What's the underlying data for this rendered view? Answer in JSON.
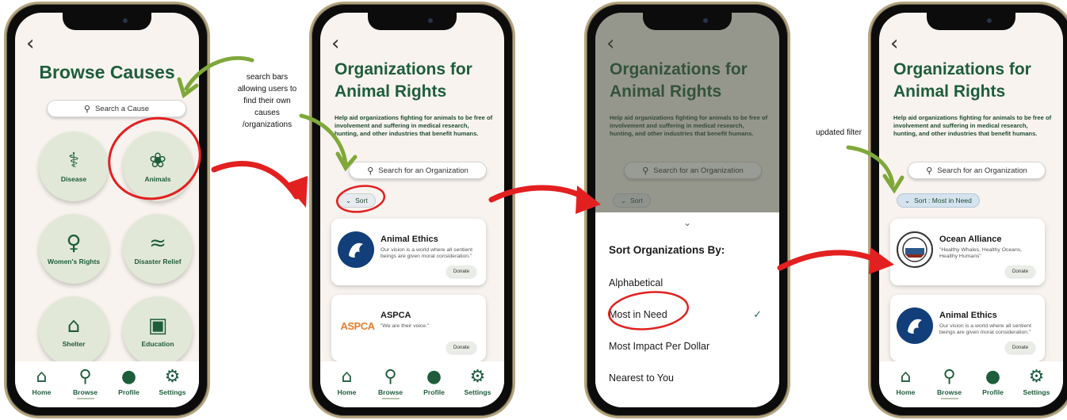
{
  "screen1": {
    "title": "Browse Causes",
    "search_placeholder": "Search a Cause",
    "causes": [
      {
        "label": "Disease",
        "icon": "stethoscope-icon"
      },
      {
        "label": "Animals",
        "icon": "animals-icon"
      },
      {
        "label": "Women's Rights",
        "icon": "female-symbol-icon"
      },
      {
        "label": "Disaster Relief",
        "icon": "wave-icon"
      },
      {
        "label": "Shelter",
        "icon": "house-icon"
      },
      {
        "label": "Education",
        "icon": "book-icon"
      }
    ]
  },
  "org_page": {
    "title": "Organizations for Animal Rights",
    "description": "Help aid organizations fighting for animals to be free of involvement and suffering in medical research, hunting, and other industries that benefit humans.",
    "search_placeholder": "Search for an Organization",
    "sort_label": "Sort",
    "sort_label_updated": "Sort : Most in Need"
  },
  "orgs": {
    "animal_ethics": {
      "name": "Animal Ethics",
      "quote": "Our vision is a world where all sentient beings are given moral consideration.\""
    },
    "aspca": {
      "name": "ASPCA",
      "quote": "\"We are their voice.\"",
      "logo_text": "ASPCA"
    },
    "ocean_alliance": {
      "name": "Ocean Alliance",
      "quote": "\"Healthy Whales, Healthy Oceans, Healthy Humans\""
    },
    "donate_label": "Donate"
  },
  "sort_sheet": {
    "title": "Sort Organizations By:",
    "options": [
      "Alphabetical",
      "Most in Need",
      "Most Impact Per Dollar",
      "Nearest to You"
    ],
    "selected": "Most in Need"
  },
  "tabbar": {
    "tabs": [
      {
        "label": "Home",
        "icon": "home-icon"
      },
      {
        "label": "Browse",
        "icon": "search-icon"
      },
      {
        "label": "Profile",
        "icon": "person-icon"
      },
      {
        "label": "Settings",
        "icon": "gear-icon"
      }
    ]
  },
  "annotations": {
    "search_note": "search bars allowing users to find their own causes /organizations",
    "filter_note": "updated filter"
  },
  "colors": {
    "brand_green": "#1e5d3b",
    "screen_bg": "#f8f3ee",
    "annotation_red": "#e32020",
    "annotation_green": "#7fa83a"
  }
}
